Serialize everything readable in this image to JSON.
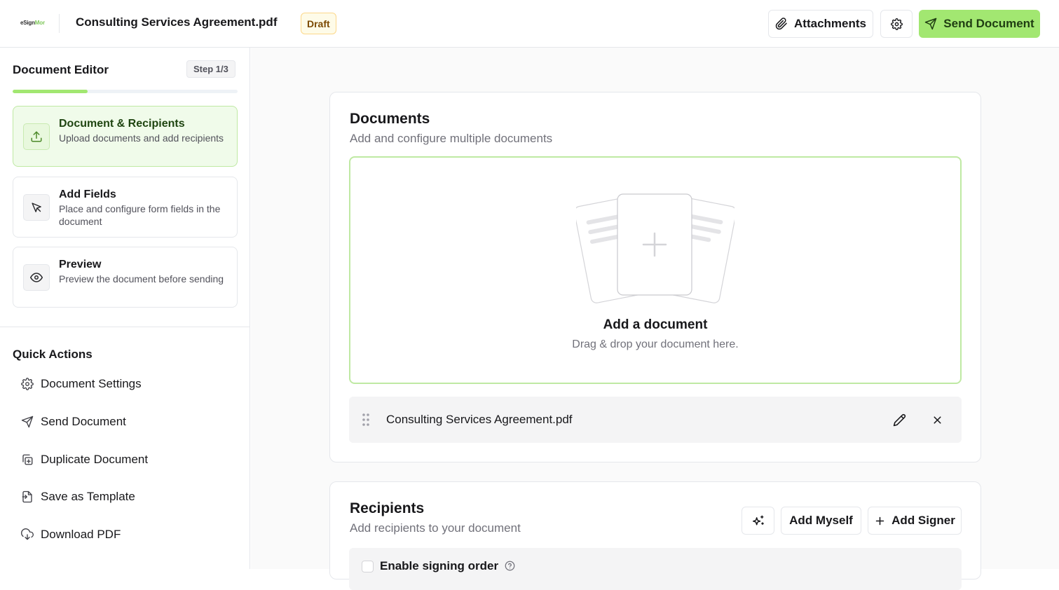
{
  "header": {
    "logo_text": "eSignMor",
    "document_title": "Consulting Services Agreement.pdf",
    "status_badge": "Draft",
    "attachments_label": "Attachments",
    "send_label": "Send Document",
    "accent_color": "#a2e771"
  },
  "sidebar": {
    "title": "Document Editor",
    "step_indicator": "Step 1/3",
    "progress_fraction": 0.333,
    "steps": [
      {
        "title": "Document & Recipients",
        "description": "Upload documents and add recipients",
        "icon": "upload-icon",
        "active": true
      },
      {
        "title": "Add Fields",
        "description": "Place and configure form fields in the document",
        "icon": "cursor-icon",
        "active": false
      },
      {
        "title": "Preview",
        "description": "Preview the document before sending",
        "icon": "eye-icon",
        "active": false
      }
    ],
    "quick_actions_title": "Quick Actions",
    "quick_actions": [
      {
        "label": "Document Settings",
        "icon": "gear-icon"
      },
      {
        "label": "Send Document",
        "icon": "send-icon"
      },
      {
        "label": "Duplicate Document",
        "icon": "duplicate-icon"
      },
      {
        "label": "Save as Template",
        "icon": "template-icon"
      },
      {
        "label": "Download PDF",
        "icon": "download-icon"
      }
    ]
  },
  "documents": {
    "title": "Documents",
    "subtitle": "Add and configure multiple documents",
    "dropzone_title": "Add a document",
    "dropzone_subtitle": "Drag & drop your document here.",
    "files": [
      {
        "name": "Consulting Services Agreement.pdf"
      }
    ]
  },
  "recipients": {
    "title": "Recipients",
    "subtitle": "Add recipients to your document",
    "add_myself_label": "Add Myself",
    "add_signer_label": "Add Signer",
    "signing_order_label": "Enable signing order"
  }
}
